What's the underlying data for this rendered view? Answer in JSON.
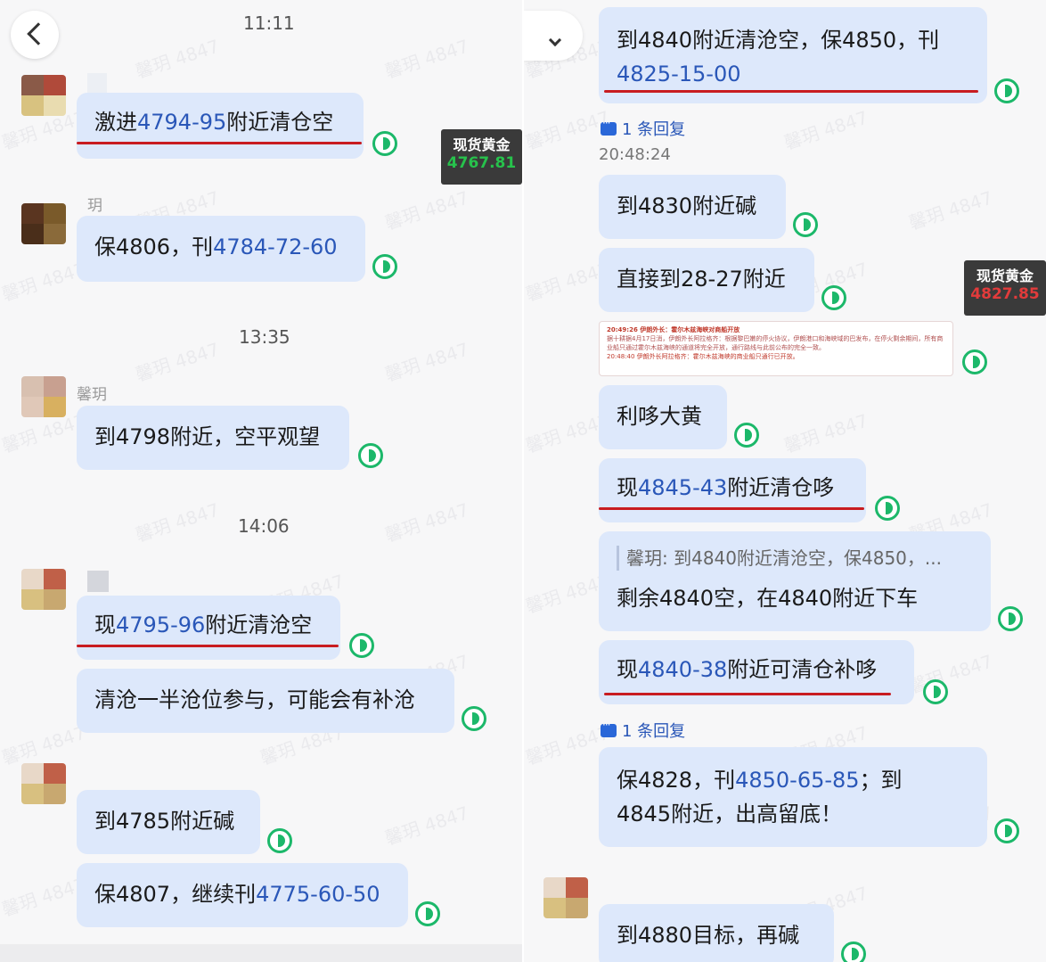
{
  "watermark": "馨玥 4847",
  "left": {
    "times": [
      "11:11",
      "13:35",
      "14:06"
    ],
    "names": [
      "玥",
      "馨玥"
    ],
    "ticker": {
      "name": "现货黄金",
      "value": "4767.81"
    },
    "messages": [
      {
        "pre": "激进",
        "hl": "4794-95",
        "post": "附近清仓空"
      },
      {
        "pre": "保4806，刊",
        "hl": "4784-72-60",
        "post": ""
      },
      {
        "pre": "到4798附近，空平观望",
        "hl": "",
        "post": ""
      },
      {
        "pre": "现",
        "hl": "4795-96",
        "post": "附近清沧空"
      },
      {
        "pre": "清沧一半沧位参与，可能会有补沧",
        "hl": "",
        "post": ""
      },
      {
        "pre": "到4785附近碱",
        "hl": "",
        "post": ""
      },
      {
        "pre": "保4807，继续刊",
        "hl": "4775-60-50",
        "post": ""
      }
    ]
  },
  "right": {
    "reply_label": "1 条回复",
    "timestamp": "20:48:24",
    "ticker": {
      "name": "现货黄金",
      "value": "4827.85"
    },
    "messages": [
      {
        "pre": "到4840附近清沧空，保4850，刊",
        "hl": "4825-15-00",
        "post": ""
      },
      {
        "pre": "到4830附近碱",
        "hl": "",
        "post": ""
      },
      {
        "pre": "直接到28-27附近",
        "hl": "",
        "post": ""
      },
      {
        "pre": "利哆大黄",
        "hl": "",
        "post": ""
      },
      {
        "pre": "现",
        "hl": "4845-43",
        "post": "附近清仓哆"
      },
      {
        "pre": "剩余4840空，在4840附近下车",
        "hl": "",
        "post": ""
      },
      {
        "pre": "现",
        "hl": "4840-38",
        "post": "附近可清仓补哆"
      },
      {
        "pre": "保4828，刊",
        "hl": "4850-65-85",
        "post": "；到"
      },
      {
        "pre": "4845附近，出高留底！",
        "hl": "",
        "post": ""
      },
      {
        "pre": "到4880目标，再碱",
        "hl": "",
        "post": ""
      }
    ],
    "quote": "馨玥: 到4840附近清沧空，保4850，...",
    "attachment": {
      "line1": "20:49:26  伊朗外长：霍尔木兹海峡对商船开放",
      "line2": "据十耕据4月17日消，伊朗外长阿拉格齐：根据黎巴嫩的停火协议，伊朗港口和海峡域的巴发布，在停火剩余期间，所有商业船只通过霍尔木兹海峡的通道将完全开放，通行路线与此前公布的完全一致。",
      "line3": "20:48:40  伊朗外长阿拉格齐：霍尔木兹海峡的商业船只通行已开放。"
    }
  }
}
